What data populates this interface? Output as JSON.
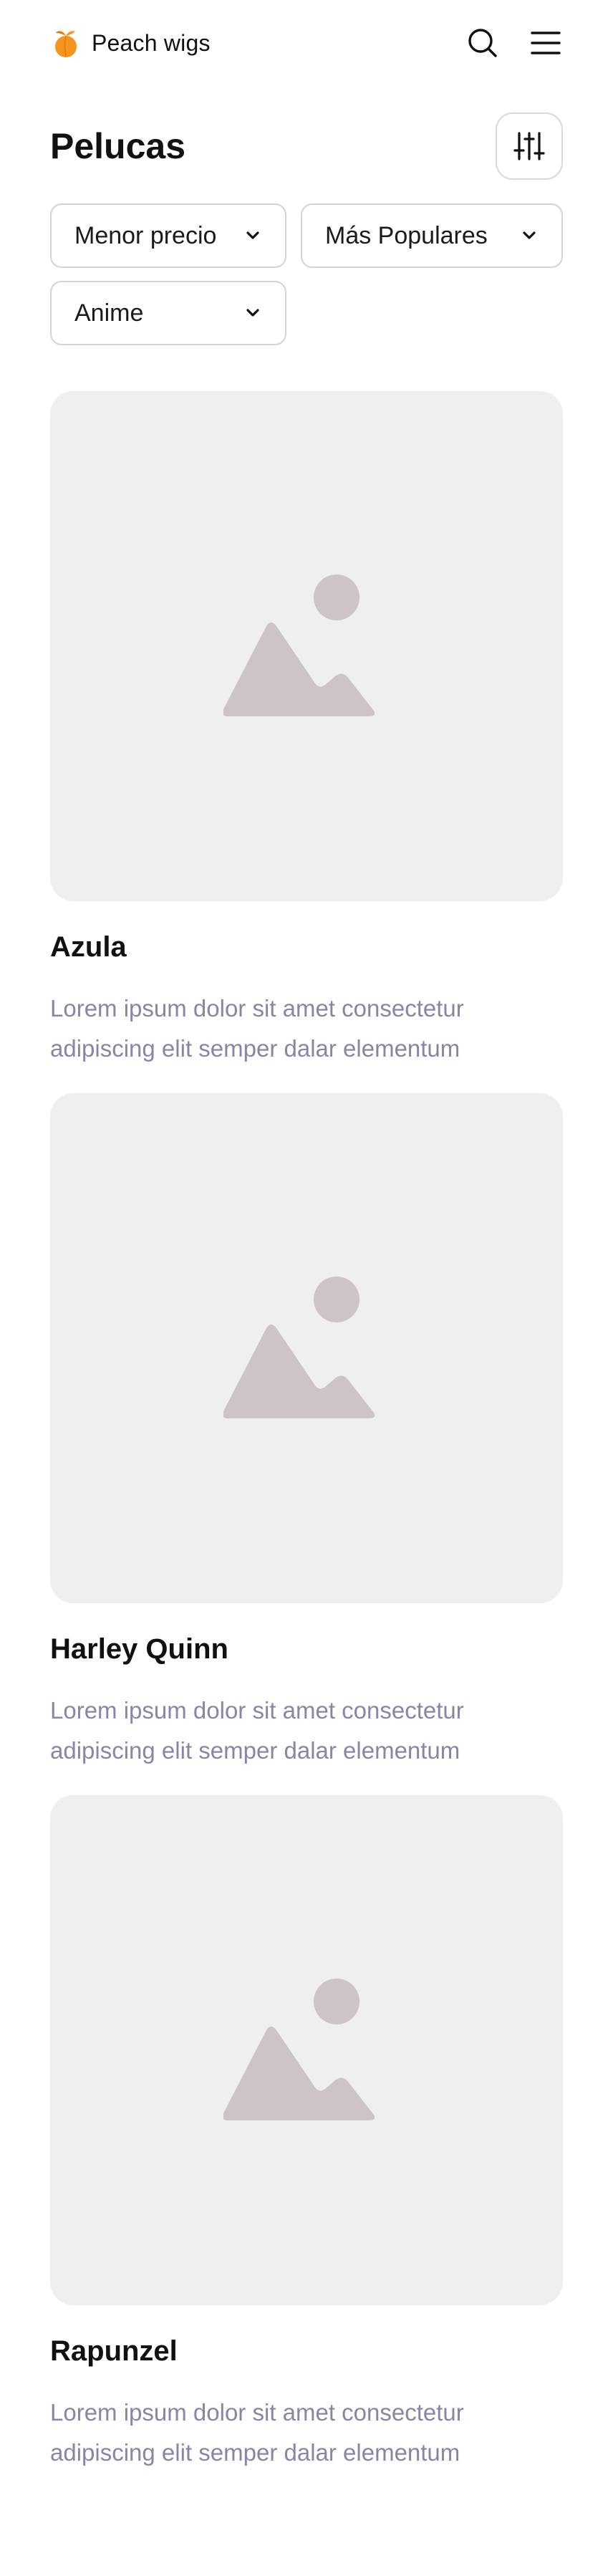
{
  "header": {
    "brand_name": "Peach wigs",
    "logo_icon": "peach-logo-icon",
    "search_icon": "search-icon",
    "menu_icon": "hamburger-menu-icon"
  },
  "page": {
    "title": "Pelucas",
    "filter_icon": "sliders-filter-icon"
  },
  "filters": [
    {
      "label": "Menor precio",
      "icon": "chevron-down-icon"
    },
    {
      "label": "Más Populares",
      "icon": "chevron-down-icon"
    },
    {
      "label": "Anime",
      "icon": "chevron-down-icon"
    }
  ],
  "products": [
    {
      "name": "Azula",
      "description": "Lorem ipsum dolor sit amet consectetur adipiscing elit semper dalar elementum",
      "image_icon": "image-placeholder-icon"
    },
    {
      "name": "Harley Quinn",
      "description": "Lorem ipsum dolor sit amet consectetur adipiscing elit semper dalar elementum",
      "image_icon": "image-placeholder-icon"
    },
    {
      "name": "Rapunzel",
      "description": "Lorem ipsum dolor sit amet consectetur adipiscing elit semper dalar elementum",
      "image_icon": "image-placeholder-icon"
    }
  ],
  "colors": {
    "brand_orange": "#F7941D",
    "leaf_orange": "#E07A10",
    "description_text": "#8A84A6",
    "placeholder_bg": "#EFEFEF",
    "placeholder_shape": "#CCC4C6"
  }
}
